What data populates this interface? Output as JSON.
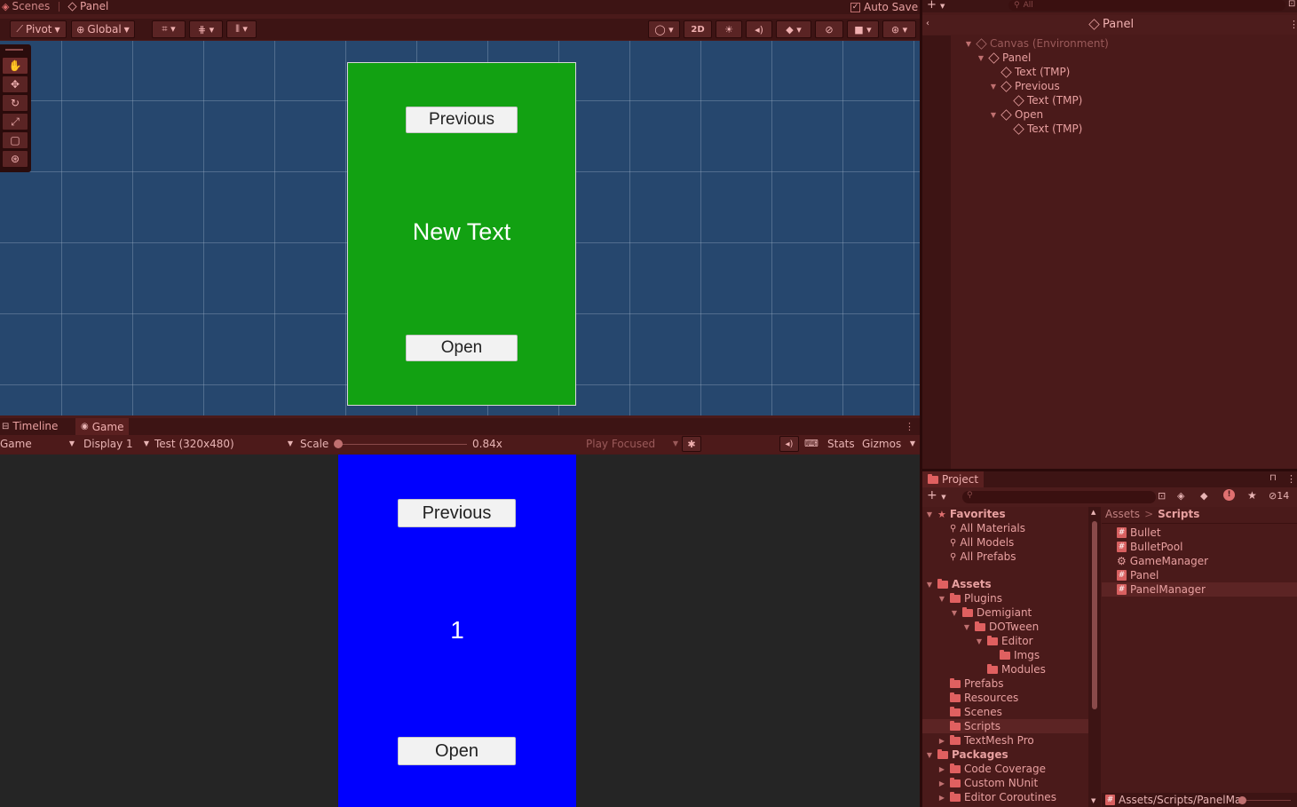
{
  "scene_tabs": {
    "scenes": "Scenes",
    "panel": "Panel",
    "auto_save": "Auto Save"
  },
  "scene_toolbar": {
    "pivot": "Pivot",
    "global": "Global",
    "mode_2d": "2D"
  },
  "scene_view": {
    "previous": "Previous",
    "title": "New Text",
    "open": "Open",
    "panel_color": "#12a112"
  },
  "game_tabs": {
    "timeline": "Timeline",
    "game": "Game"
  },
  "game_toolbar": {
    "game": "Game",
    "display": "Display 1",
    "resolution": "Test (320x480)",
    "scale_label": "Scale",
    "scale_value": "0.84x",
    "play_focused": "Play Focused",
    "stats": "Stats",
    "gizmos": "Gizmos"
  },
  "game_view": {
    "previous": "Previous",
    "number": "1",
    "open": "Open",
    "panel_color": "#0000ff"
  },
  "hierarchy": {
    "search_placeholder": "All",
    "title": "Panel",
    "items": [
      {
        "label": "Canvas (Environment)",
        "caret": "▼",
        "dim": true
      },
      {
        "label": "Panel",
        "caret": "▼"
      },
      {
        "label": "Text (TMP)",
        "caret": ""
      },
      {
        "label": "Previous",
        "caret": "▼"
      },
      {
        "label": "Text (TMP)",
        "caret": ""
      },
      {
        "label": "Open",
        "caret": "▼"
      },
      {
        "label": "Text (TMP)",
        "caret": ""
      }
    ]
  },
  "project": {
    "title": "Project",
    "hidden_count": "14",
    "favorites": {
      "label": "Favorites",
      "items": [
        "All Materials",
        "All Models",
        "All Prefabs"
      ]
    },
    "tree": [
      {
        "label": "Assets",
        "caret": "▼",
        "bold": true
      },
      {
        "label": "Plugins",
        "caret": "▼"
      },
      {
        "label": "Demigiant",
        "caret": "▼"
      },
      {
        "label": "DOTween",
        "caret": "▼"
      },
      {
        "label": "Editor",
        "caret": "▼"
      },
      {
        "label": "Imgs",
        "caret": ""
      },
      {
        "label": "Modules",
        "caret": ""
      },
      {
        "label": "Prefabs",
        "caret": ""
      },
      {
        "label": "Resources",
        "caret": ""
      },
      {
        "label": "Scenes",
        "caret": ""
      },
      {
        "label": "Scripts",
        "caret": "",
        "selected": true
      },
      {
        "label": "TextMesh Pro",
        "caret": "▶"
      },
      {
        "label": "Packages",
        "caret": "▼",
        "bold": true
      },
      {
        "label": "Code Coverage",
        "caret": "▶"
      },
      {
        "label": "Custom NUnit",
        "caret": "▶"
      },
      {
        "label": "Editor Coroutines",
        "caret": "▶"
      }
    ],
    "breadcrumb": {
      "root": "Assets",
      "sep": ">",
      "current": "Scripts"
    },
    "files": [
      {
        "label": "Bullet",
        "icon": "#"
      },
      {
        "label": "BulletPool",
        "icon": "#"
      },
      {
        "label": "GameManager",
        "icon": "⚙"
      },
      {
        "label": "Panel",
        "icon": "#"
      },
      {
        "label": "PanelManager",
        "icon": "#",
        "selected": true
      }
    ],
    "status_path": "Assets/Scripts/PanelMa"
  }
}
